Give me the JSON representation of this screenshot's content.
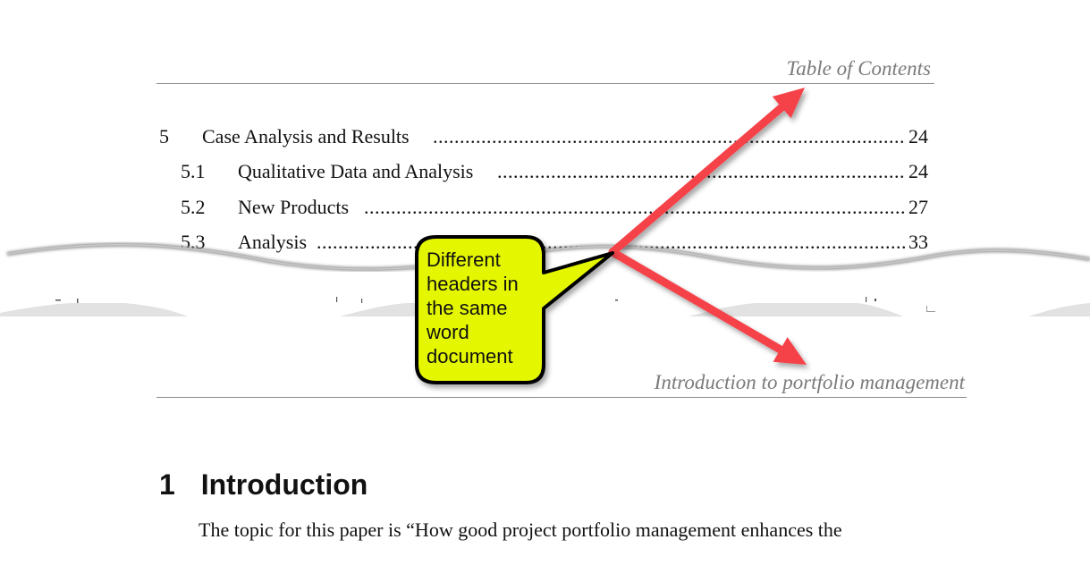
{
  "page_top": {
    "header": "Table of Contents",
    "toc": [
      {
        "number": "5",
        "title": "Case Analysis and Results",
        "page": "24",
        "level": 1
      },
      {
        "number": "5.1",
        "title": "Qualitative Data and Analysis",
        "page": "24",
        "level": 2
      },
      {
        "number": "5.2",
        "title": "New Products",
        "page": "27",
        "level": 2
      },
      {
        "number": "5.3",
        "title": "Analysis",
        "page": "33",
        "level": 2
      }
    ]
  },
  "page_bottom": {
    "header": "Introduction to portfolio management",
    "heading": {
      "number": "1",
      "title": "Introduction"
    },
    "body_text": "The topic for this paper is “How good project portfolio management enhances the"
  },
  "annotation": {
    "callout_text": [
      "Different",
      "headers in",
      "the same",
      "word",
      "document"
    ],
    "callout_fill": "#e5f700",
    "arrow_color": "#f5434a",
    "arrow_targets": [
      "Table of Contents header",
      "Introduction to portfolio management header"
    ]
  }
}
